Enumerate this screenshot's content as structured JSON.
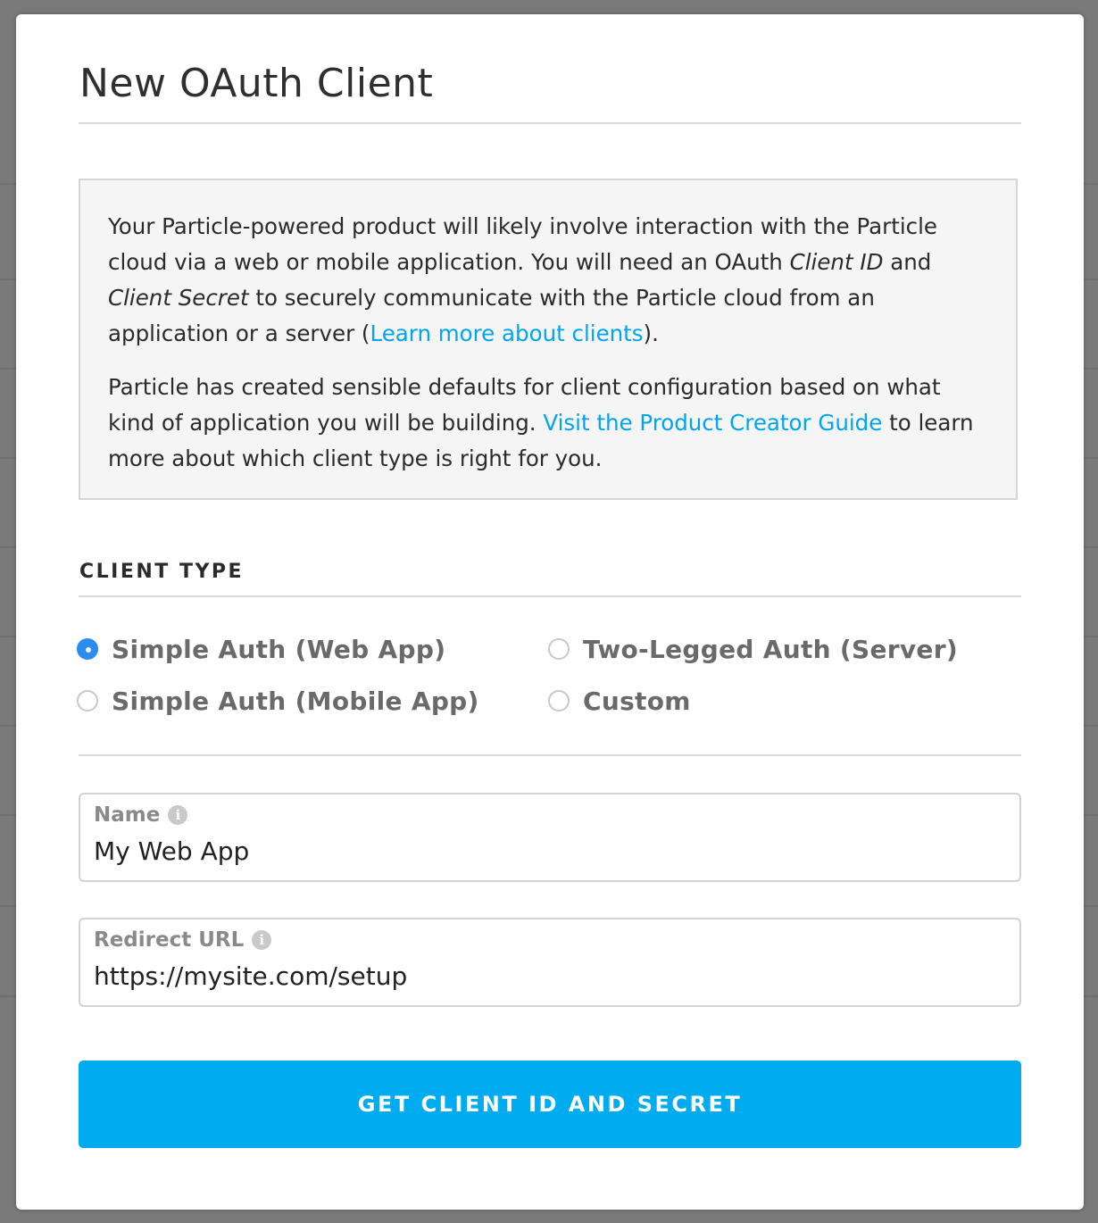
{
  "modal": {
    "title": "New OAuth Client"
  },
  "intro": {
    "p1_text1": "Your Particle-powered product will likely involve interaction with the Particle cloud via a web or mobile application. You will need an OAuth ",
    "p1_em1": "Client ID",
    "p1_text2": " and ",
    "p1_em2": "Client Secret",
    "p1_text3": " to securely communicate with the Particle cloud from an application or a server (",
    "p1_link": "Learn more about clients",
    "p1_text4": ").",
    "p2_text1": "Particle has created sensible defaults for client configuration based on what kind of application you will be building. ",
    "p2_link": "Visit the Product Creator Guide",
    "p2_text2": " to learn more about which client type is right for you."
  },
  "client_type": {
    "label": "CLIENT TYPE",
    "options": [
      {
        "label": "Simple Auth (Web App)",
        "checked": true
      },
      {
        "label": "Two-Legged Auth (Server)",
        "checked": false
      },
      {
        "label": "Simple Auth (Mobile App)",
        "checked": false
      },
      {
        "label": "Custom",
        "checked": false
      }
    ]
  },
  "fields": {
    "name": {
      "label": "Name",
      "value": "My Web App",
      "icon": "info-icon"
    },
    "redirect_url": {
      "label": "Redirect URL",
      "value": "https://mysite.com/setup",
      "icon": "info-icon"
    }
  },
  "submit": {
    "label": "GET CLIENT ID AND SECRET"
  },
  "colors": {
    "accent": "#00abf0",
    "link": "#00a5ec",
    "radio_selected": "#2a8cf0"
  }
}
